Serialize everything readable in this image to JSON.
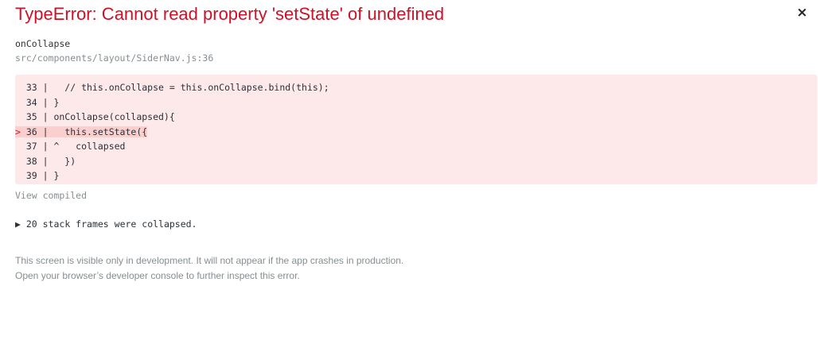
{
  "error": {
    "title": "TypeError: Cannot read property 'setState' of undefined",
    "close_glyph": "×"
  },
  "frame": {
    "function_name": "onCollapse",
    "file_location": "src/components/layout/SiderNav.js:36"
  },
  "code": {
    "lines": [
      {
        "text": "  33 |   // this.onCollapse = this.onCollapse.bind(this);",
        "highlighted": false
      },
      {
        "text": "  34 | }",
        "highlighted": false
      },
      {
        "text": "  35 | onCollapse(collapsed){",
        "highlighted": false
      },
      {
        "marker": "> ",
        "text": "36 |   this.setState({",
        "highlighted": true
      },
      {
        "text": "  37 | ^   collapsed",
        "highlighted": false
      },
      {
        "text": "  38 |   })",
        "highlighted": false
      },
      {
        "text": "  39 | }",
        "highlighted": false
      }
    ]
  },
  "view_compiled_label": "View compiled",
  "stack": {
    "toggle_icon": "▶",
    "label": "20 stack frames were collapsed."
  },
  "footer": {
    "line1": "This screen is visible only in development. It will not appear if the app crashes in production.",
    "line2": "Open your browser’s developer console to further inspect this error."
  },
  "colors": {
    "error_red": "#ce1126",
    "code_background": "#fde8ea",
    "highlight_background": "#fccfcf",
    "muted_text": "#878e91"
  }
}
